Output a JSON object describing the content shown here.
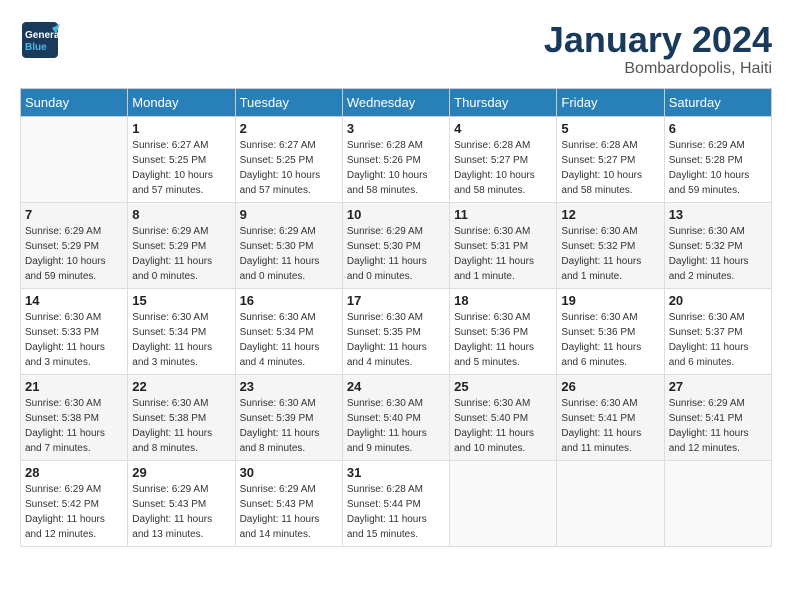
{
  "logo": {
    "line1": "General",
    "line2": "Blue"
  },
  "title": "January 2024",
  "location": "Bombardopolis, Haiti",
  "days_header": [
    "Sunday",
    "Monday",
    "Tuesday",
    "Wednesday",
    "Thursday",
    "Friday",
    "Saturday"
  ],
  "weeks": [
    [
      {
        "num": "",
        "info": ""
      },
      {
        "num": "1",
        "info": "Sunrise: 6:27 AM\nSunset: 5:25 PM\nDaylight: 10 hours\nand 57 minutes."
      },
      {
        "num": "2",
        "info": "Sunrise: 6:27 AM\nSunset: 5:25 PM\nDaylight: 10 hours\nand 57 minutes."
      },
      {
        "num": "3",
        "info": "Sunrise: 6:28 AM\nSunset: 5:26 PM\nDaylight: 10 hours\nand 58 minutes."
      },
      {
        "num": "4",
        "info": "Sunrise: 6:28 AM\nSunset: 5:27 PM\nDaylight: 10 hours\nand 58 minutes."
      },
      {
        "num": "5",
        "info": "Sunrise: 6:28 AM\nSunset: 5:27 PM\nDaylight: 10 hours\nand 58 minutes."
      },
      {
        "num": "6",
        "info": "Sunrise: 6:29 AM\nSunset: 5:28 PM\nDaylight: 10 hours\nand 59 minutes."
      }
    ],
    [
      {
        "num": "7",
        "info": "Sunrise: 6:29 AM\nSunset: 5:29 PM\nDaylight: 10 hours\nand 59 minutes."
      },
      {
        "num": "8",
        "info": "Sunrise: 6:29 AM\nSunset: 5:29 PM\nDaylight: 11 hours\nand 0 minutes."
      },
      {
        "num": "9",
        "info": "Sunrise: 6:29 AM\nSunset: 5:30 PM\nDaylight: 11 hours\nand 0 minutes."
      },
      {
        "num": "10",
        "info": "Sunrise: 6:29 AM\nSunset: 5:30 PM\nDaylight: 11 hours\nand 0 minutes."
      },
      {
        "num": "11",
        "info": "Sunrise: 6:30 AM\nSunset: 5:31 PM\nDaylight: 11 hours\nand 1 minute."
      },
      {
        "num": "12",
        "info": "Sunrise: 6:30 AM\nSunset: 5:32 PM\nDaylight: 11 hours\nand 1 minute."
      },
      {
        "num": "13",
        "info": "Sunrise: 6:30 AM\nSunset: 5:32 PM\nDaylight: 11 hours\nand 2 minutes."
      }
    ],
    [
      {
        "num": "14",
        "info": "Sunrise: 6:30 AM\nSunset: 5:33 PM\nDaylight: 11 hours\nand 3 minutes."
      },
      {
        "num": "15",
        "info": "Sunrise: 6:30 AM\nSunset: 5:34 PM\nDaylight: 11 hours\nand 3 minutes."
      },
      {
        "num": "16",
        "info": "Sunrise: 6:30 AM\nSunset: 5:34 PM\nDaylight: 11 hours\nand 4 minutes."
      },
      {
        "num": "17",
        "info": "Sunrise: 6:30 AM\nSunset: 5:35 PM\nDaylight: 11 hours\nand 4 minutes."
      },
      {
        "num": "18",
        "info": "Sunrise: 6:30 AM\nSunset: 5:36 PM\nDaylight: 11 hours\nand 5 minutes."
      },
      {
        "num": "19",
        "info": "Sunrise: 6:30 AM\nSunset: 5:36 PM\nDaylight: 11 hours\nand 6 minutes."
      },
      {
        "num": "20",
        "info": "Sunrise: 6:30 AM\nSunset: 5:37 PM\nDaylight: 11 hours\nand 6 minutes."
      }
    ],
    [
      {
        "num": "21",
        "info": "Sunrise: 6:30 AM\nSunset: 5:38 PM\nDaylight: 11 hours\nand 7 minutes."
      },
      {
        "num": "22",
        "info": "Sunrise: 6:30 AM\nSunset: 5:38 PM\nDaylight: 11 hours\nand 8 minutes."
      },
      {
        "num": "23",
        "info": "Sunrise: 6:30 AM\nSunset: 5:39 PM\nDaylight: 11 hours\nand 8 minutes."
      },
      {
        "num": "24",
        "info": "Sunrise: 6:30 AM\nSunset: 5:40 PM\nDaylight: 11 hours\nand 9 minutes."
      },
      {
        "num": "25",
        "info": "Sunrise: 6:30 AM\nSunset: 5:40 PM\nDaylight: 11 hours\nand 10 minutes."
      },
      {
        "num": "26",
        "info": "Sunrise: 6:30 AM\nSunset: 5:41 PM\nDaylight: 11 hours\nand 11 minutes."
      },
      {
        "num": "27",
        "info": "Sunrise: 6:29 AM\nSunset: 5:41 PM\nDaylight: 11 hours\nand 12 minutes."
      }
    ],
    [
      {
        "num": "28",
        "info": "Sunrise: 6:29 AM\nSunset: 5:42 PM\nDaylight: 11 hours\nand 12 minutes."
      },
      {
        "num": "29",
        "info": "Sunrise: 6:29 AM\nSunset: 5:43 PM\nDaylight: 11 hours\nand 13 minutes."
      },
      {
        "num": "30",
        "info": "Sunrise: 6:29 AM\nSunset: 5:43 PM\nDaylight: 11 hours\nand 14 minutes."
      },
      {
        "num": "31",
        "info": "Sunrise: 6:28 AM\nSunset: 5:44 PM\nDaylight: 11 hours\nand 15 minutes."
      },
      {
        "num": "",
        "info": ""
      },
      {
        "num": "",
        "info": ""
      },
      {
        "num": "",
        "info": ""
      }
    ]
  ]
}
